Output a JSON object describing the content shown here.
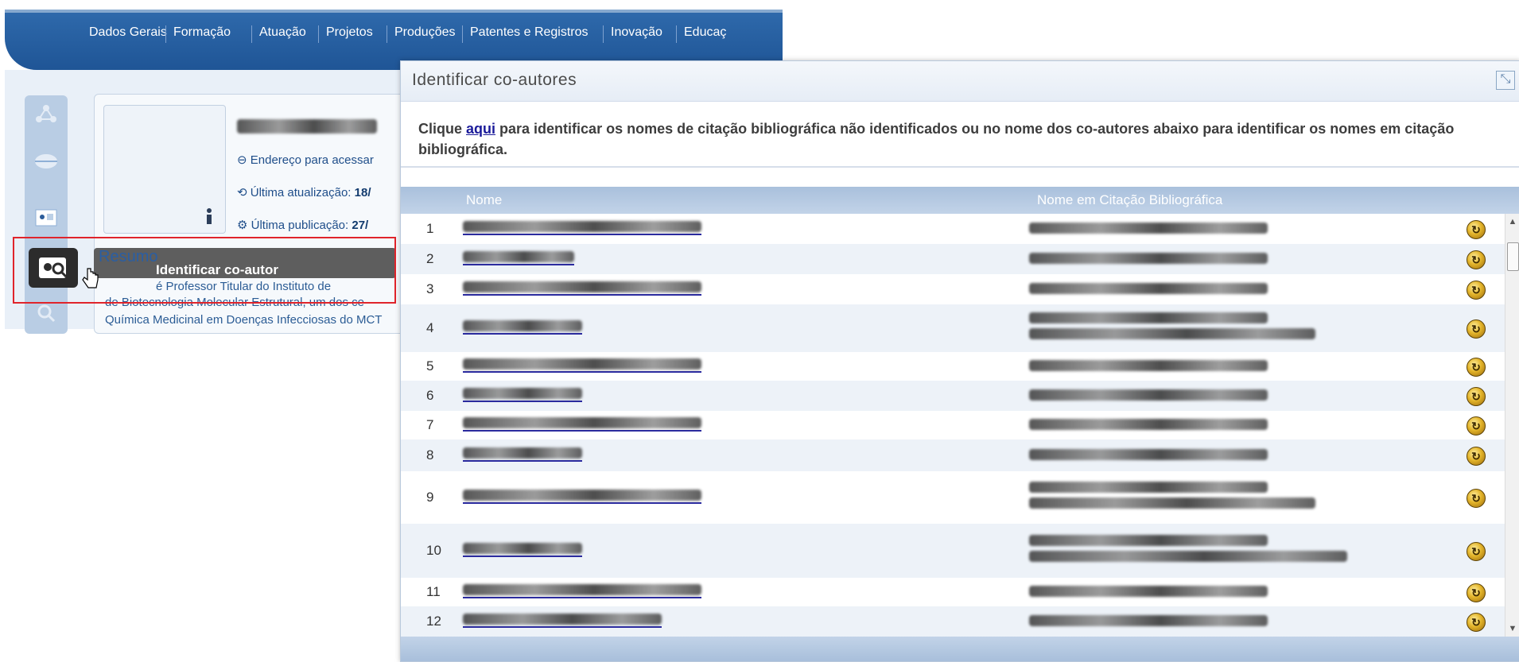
{
  "nav": {
    "items": [
      "Dados Gerais",
      "Formação",
      "Atuação",
      "Projetos",
      "Produções",
      "Patentes e Registros",
      "Inovação",
      "Educaç"
    ]
  },
  "profile": {
    "address_label": "Endereço para acessar",
    "updated_label": "Última atualização:",
    "updated_value": "18/",
    "published_label": "Última publicação:",
    "published_value": "27/"
  },
  "resumo": {
    "title": "Resumo",
    "tooltip": "Identificar co-autor",
    "lines": [
      "é Professor Titular do Instituto de",
      "de Biotecnologia Molecular Estrutural, um dos ce",
      "Química Medicinal em Doenças Infecciosas do MCT"
    ]
  },
  "modal": {
    "title": "Identificar co-autores",
    "close_icon": "collapse-icon",
    "intro_before": "Clique ",
    "intro_link": "aqui",
    "intro_after": " para identificar os nomes de citação bibliográfica não identificados ou no nome dos co-autores abaixo para identificar os nomes em citação bibliográfica.",
    "columns": {
      "name": "Nome",
      "citation": "Nome em Citação Bibliográfica"
    },
    "rows": [
      {
        "num": "1"
      },
      {
        "num": "2"
      },
      {
        "num": "3"
      },
      {
        "num": "4"
      },
      {
        "num": "5"
      },
      {
        "num": "6"
      },
      {
        "num": "7"
      },
      {
        "num": "8"
      },
      {
        "num": "9"
      },
      {
        "num": "10"
      },
      {
        "num": "11"
      },
      {
        "num": "12"
      }
    ]
  },
  "colors": {
    "nav_bg": "#1f5596",
    "header_bg": "#a9c0dc",
    "link": "#1b1b9a",
    "highlight": "#e0242b"
  }
}
